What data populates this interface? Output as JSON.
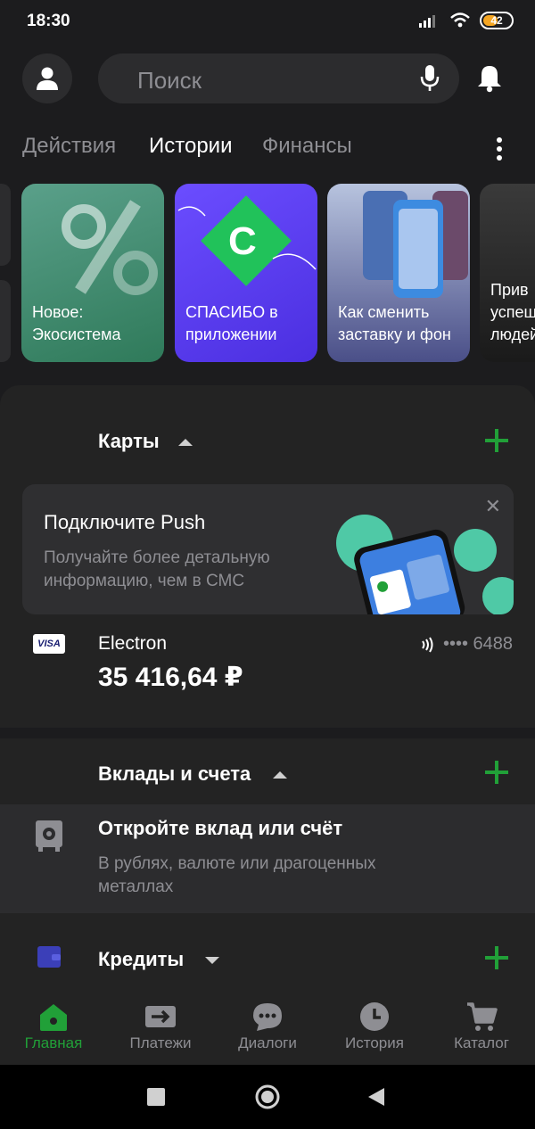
{
  "status_bar": {
    "time": "18:30",
    "battery": "42"
  },
  "header": {
    "search_placeholder": "Поиск"
  },
  "tabs": [
    "Действия",
    "Истории",
    "Финансы"
  ],
  "stories": [
    {
      "label": "Новое: Экосистема"
    },
    {
      "label": "СПАСИБО в приложении",
      "badge": "С"
    },
    {
      "label": "Как сменить заставку и фон"
    },
    {
      "label": "Прив успеш людей"
    }
  ],
  "cards_section": {
    "title": "Карты",
    "push": {
      "title": "Подключите Push",
      "text": "Получайте более детальную информацию, чем в СМС"
    },
    "card": {
      "brand": "VISA",
      "name": "Electron",
      "balance": "35 416,64 ₽",
      "number": "•••• 6488"
    }
  },
  "deposits_section": {
    "title": "Вклады и счета",
    "row_title": "Откройте вклад или счёт",
    "row_text": "В рублях, валюте или драгоценных металлах"
  },
  "credits_section": {
    "title": "Кредиты"
  },
  "bottom_nav": [
    {
      "label": "Главная",
      "icon": "home-icon"
    },
    {
      "label": "Платежи",
      "icon": "transfer-icon"
    },
    {
      "label": "Диалоги",
      "icon": "chat-icon"
    },
    {
      "label": "История",
      "icon": "clock-icon"
    },
    {
      "label": "Каталог",
      "icon": "cart-icon"
    }
  ],
  "colors": {
    "accent": "#21a038",
    "background": "#1c1c1e",
    "panel": "#232323"
  }
}
